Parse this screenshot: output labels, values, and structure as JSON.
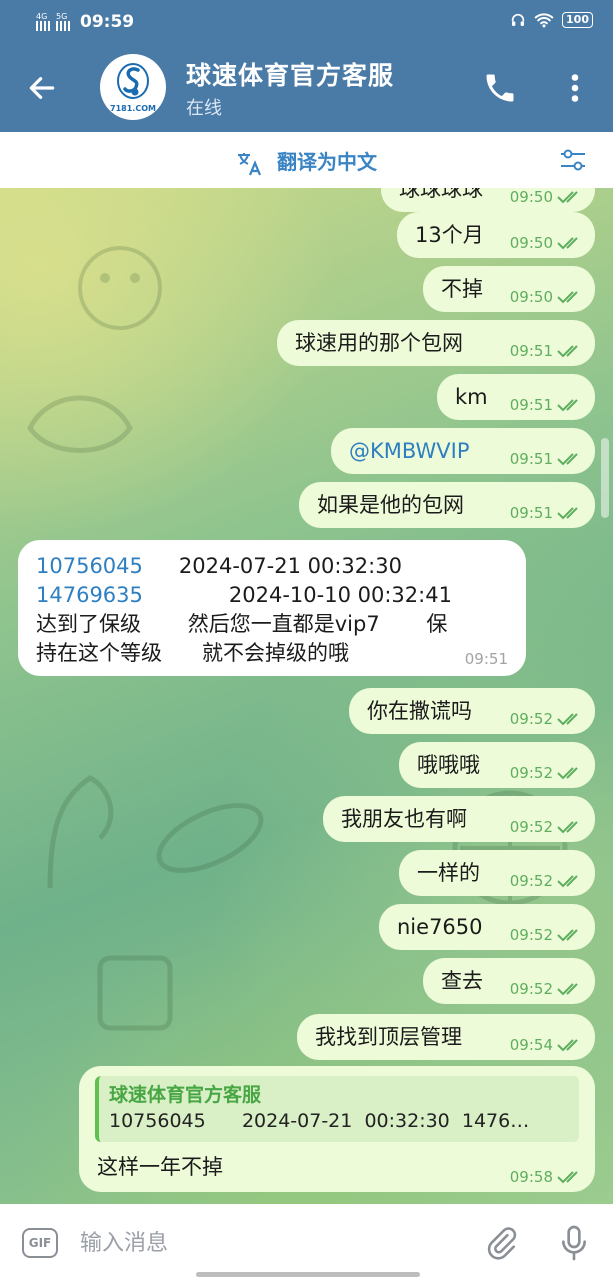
{
  "status_bar": {
    "time": "09:59",
    "net1": "4G",
    "net2": "5G",
    "battery": "100"
  },
  "header": {
    "title": "球速体育官方客服",
    "subtitle": "在线",
    "avatar_text": "7181.COM"
  },
  "translate_bar": {
    "label": "翻译为中文"
  },
  "messages": [
    {
      "text": "球球球球",
      "time": "09:50",
      "dir": "out"
    },
    {
      "text": "13个月",
      "time": "09:50",
      "dir": "out"
    },
    {
      "text": "不掉",
      "time": "09:50",
      "dir": "out"
    },
    {
      "text": "球速用的那个包网",
      "time": "09:51",
      "dir": "out"
    },
    {
      "text": "km",
      "time": "09:51",
      "dir": "out"
    },
    {
      "text": "@KMBWVIP",
      "time": "09:51",
      "dir": "out"
    },
    {
      "text": "如果是他的包网",
      "time": "09:51",
      "dir": "out"
    },
    {
      "dir": "in",
      "time": "09:51",
      "line1_id": "10756045",
      "line1_date": "2024-07-21  00:32:30",
      "line2_id": "14769635",
      "line2_date": "2024-10-10  00:32:41",
      "line3": "达到了保级       然后您一直都是vip7       保",
      "line4": "持在这个等级      就不会掉级的哦"
    },
    {
      "text": "你在撒谎吗",
      "time": "09:52",
      "dir": "out"
    },
    {
      "text": "哦哦哦",
      "time": "09:52",
      "dir": "out"
    },
    {
      "text": "我朋友也有啊",
      "time": "09:52",
      "dir": "out"
    },
    {
      "text": "一样的",
      "time": "09:52",
      "dir": "out"
    },
    {
      "text": "nie7650",
      "time": "09:52",
      "dir": "out"
    },
    {
      "text": "查去",
      "time": "09:52",
      "dir": "out"
    },
    {
      "text": "我找到顶层管理",
      "time": "09:54",
      "dir": "out"
    },
    {
      "dir": "out",
      "time": "09:58",
      "reply_name": "球速体育官方客服",
      "reply_text": "10756045      2024-07-21  00:32:30  1476…",
      "text": "这样一年不掉"
    }
  ],
  "composer": {
    "placeholder": "输入消息",
    "gif_label": "GIF"
  },
  "colors": {
    "header": "#4a7aa6",
    "out_bubble": "#eefbd9",
    "in_bubble": "#ffffff",
    "accent": "#3a84c4",
    "check": "#5fae5f"
  }
}
